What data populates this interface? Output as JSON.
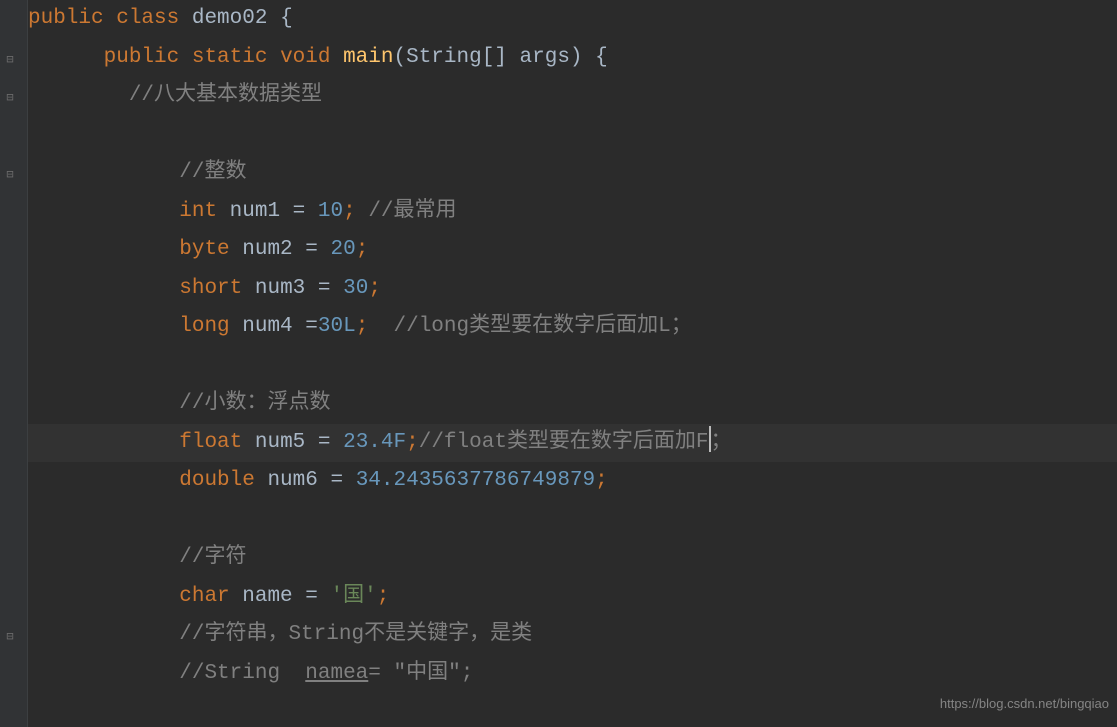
{
  "code": {
    "line1": {
      "public": "public ",
      "class": "class ",
      "demo02": "demo02 ",
      "brace": "{"
    },
    "line2": {
      "public": "public ",
      "static": "static ",
      "void": "void ",
      "main": "main",
      "params": "(String[] args) ",
      "brace": "{"
    },
    "line3": {
      "indent": "        ",
      "comment_slash": "//",
      "comment_text": "八大基本数据类型"
    },
    "line5": {
      "comment_slash": "//",
      "comment_text": "整数"
    },
    "line6": {
      "int": "int ",
      "num1": "num1 ",
      "eq": "= ",
      "val": "10",
      "semi": "; ",
      "comment_slash": "//",
      "comment_text": "最常用"
    },
    "line7": {
      "byte": "byte ",
      "num2": "num2 ",
      "eq": "= ",
      "val": "20",
      "semi": ";"
    },
    "line8": {
      "short": "short ",
      "num3": "num3 ",
      "eq": "= ",
      "val": "30",
      "semi": ";"
    },
    "line9": {
      "long": "long ",
      "num4": "num4 ",
      "eq": "=",
      "val": "30L",
      "semi": ";  ",
      "comment_slash": "//long",
      "comment_text": "类型要在数字后面加L；"
    },
    "line11": {
      "comment_slash": "//",
      "comment_text": "小数：浮点数"
    },
    "line12": {
      "float": "float ",
      "num5": "num5 ",
      "eq": "= ",
      "val": "23.4F",
      "semi": ";",
      "comment_slash": "//float",
      "comment_text": "类型要在数字后面加F",
      "comment_end": "；"
    },
    "line13": {
      "double": "double ",
      "num6": "num6 ",
      "eq": "= ",
      "val": "34.2435637786749879",
      "semi": ";"
    },
    "line15": {
      "comment_slash": "//",
      "comment_text": "字符"
    },
    "line16": {
      "char": "char ",
      "name": "name ",
      "eq": "= ",
      "val": "'国'",
      "semi": ";"
    },
    "line17": {
      "comment_slash": "//",
      "comment_text1": "字符串，",
      "string_word": "String",
      "comment_text2": "不是关键字，是类"
    },
    "line18": {
      "comment_slash": "//String  ",
      "namea": "namea",
      "rest": "= \"中国\";"
    }
  },
  "indent": {
    "c1": "      ",
    "c2": "            "
  },
  "watermark": "https://blog.csdn.net/bingqiao"
}
